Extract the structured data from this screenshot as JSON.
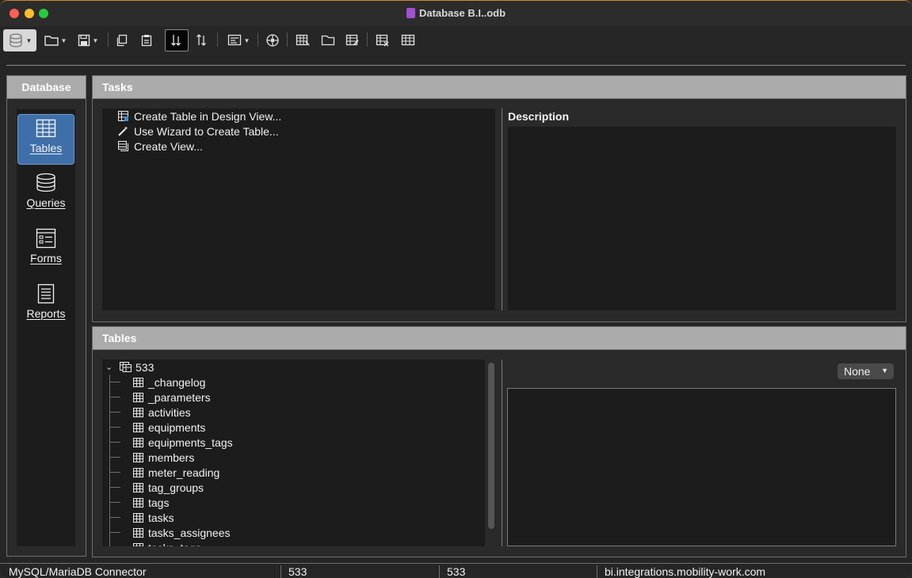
{
  "window": {
    "title": "Database B.I..odb"
  },
  "toolbar": {
    "items": [
      "database",
      "open",
      "save",
      "copy",
      "paste",
      "sort-ascending",
      "sort-descending",
      "form-filter",
      "navigator",
      "table-design",
      "open-folder",
      "edit-table",
      "delete-table",
      "table-view"
    ]
  },
  "left": {
    "header": "Database",
    "nav": [
      {
        "label": "Tables",
        "icon": "table-icon"
      },
      {
        "label": "Queries",
        "icon": "database-icon"
      },
      {
        "label": "Forms",
        "icon": "form-icon"
      },
      {
        "label": "Reports",
        "icon": "report-icon"
      }
    ]
  },
  "tasks": {
    "header": "Tasks",
    "items": [
      {
        "label": "Create Table in Design View...",
        "icon": "design-table-icon"
      },
      {
        "label": "Use Wizard to Create Table...",
        "icon": "wizard-wand-icon"
      },
      {
        "label": "Create View...",
        "icon": "view-icon"
      }
    ],
    "description_label": "Description"
  },
  "tables": {
    "header": "Tables",
    "root": "533",
    "items": [
      "_changelog",
      "_parameters",
      "activities",
      "equipments",
      "equipments_tags",
      "members",
      "meter_reading",
      "tag_groups",
      "tags",
      "tasks",
      "tasks_assignees",
      "tasks_tags"
    ],
    "preview_select": "None"
  },
  "status": {
    "connector": "MySQL/MariaDB Connector",
    "field2": "533",
    "field3": "533",
    "host": "bi.integrations.mobility-work.com"
  },
  "colors": {
    "accent": "#3f6fa8",
    "header_bg": "#ababab",
    "panel_bg": "#1c1c1c"
  }
}
